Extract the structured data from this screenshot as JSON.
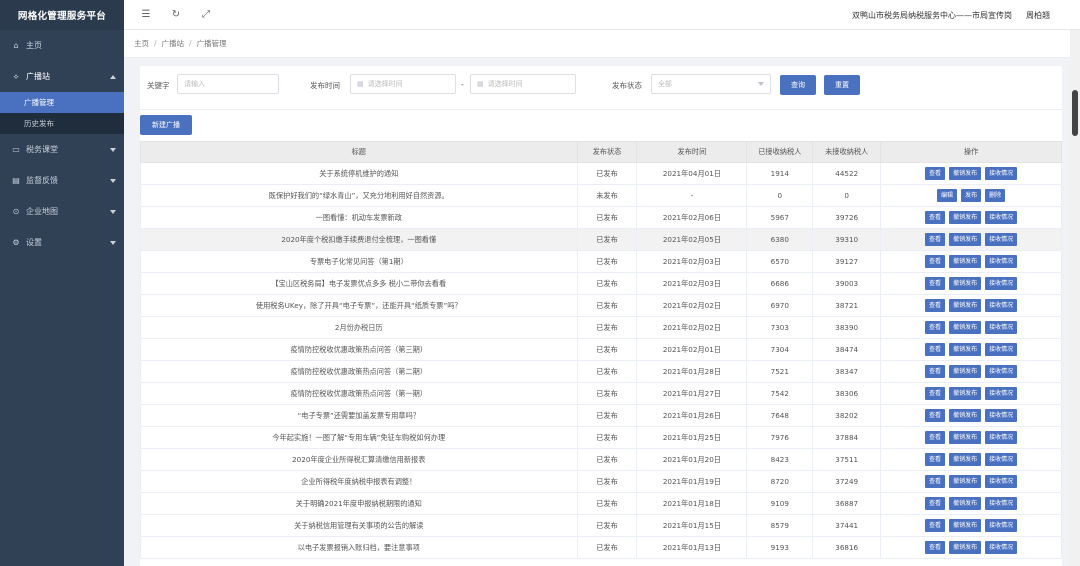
{
  "app": {
    "title": "网格化管理服务平台"
  },
  "sidebar": {
    "items": [
      {
        "icon": "home-icon",
        "glyph": "⌂",
        "label": "主页",
        "has_sub": false
      },
      {
        "icon": "broadcast-icon",
        "glyph": "⟡",
        "label": "广播站",
        "has_sub": true,
        "open": true,
        "children": [
          {
            "label": "广播管理",
            "active": true
          },
          {
            "label": "历史发布",
            "active": false
          }
        ]
      },
      {
        "icon": "classroom-icon",
        "glyph": "▭",
        "label": "税务课堂",
        "has_sub": true
      },
      {
        "icon": "feedback-icon",
        "glyph": "▤",
        "label": "监督反馈",
        "has_sub": true
      },
      {
        "icon": "map-pin-icon",
        "glyph": "⊙",
        "label": "企业地图",
        "has_sub": true
      },
      {
        "icon": "gear-icon",
        "glyph": "⚙",
        "label": "设置",
        "has_sub": true
      }
    ]
  },
  "header": {
    "org": "双鸭山市税务局纳税服务中心——市局宣传岗",
    "user": "周柏翘"
  },
  "breadcrumb": [
    "主页",
    "广播站",
    "广播管理"
  ],
  "filters": {
    "keyword_label": "关键字",
    "keyword_placeholder": "请输入",
    "time_label": "发布时间",
    "time_start_placeholder": "请选择时间",
    "time_end_placeholder": "请选择时间",
    "time_sep": "-",
    "status_label": "发布状态",
    "status_value": "全部",
    "search_label": "查询",
    "reset_label": "重置"
  },
  "new_button": "新建广播",
  "table": {
    "headers": [
      "标题",
      "发布状态",
      "发布时间",
      "已接收纳税人",
      "未接收纳税人",
      "操作"
    ],
    "rows": [
      [
        "关于系统停机维护的通知",
        "已发布",
        "2021年04月01日",
        "1914",
        "44522"
      ],
      [
        "既保护好我们的“绿水青山”，又充分地利用好自然资源。",
        "未发布",
        "-",
        "0",
        "0"
      ],
      [
        "一图看懂：机动车发票新政",
        "已发布",
        "2021年02月06日",
        "5967",
        "39726"
      ],
      [
        "2020年度个税扣缴手续费退付全梳理，一图看懂",
        "已发布",
        "2021年02月05日",
        "6380",
        "39310"
      ],
      [
        "专票电子化常见问答（第1期）",
        "已发布",
        "2021年02月03日",
        "6570",
        "39127"
      ],
      [
        "【宝山区税务局】电子发票优点多多 税小二带你去看看",
        "已发布",
        "2021年02月03日",
        "6686",
        "39003"
      ],
      [
        "使用税务UKey，除了开具“电子专票”，还能开具“纸质专票”吗？",
        "已发布",
        "2021年02月02日",
        "6970",
        "38721"
      ],
      [
        "2月份办税日历",
        "已发布",
        "2021年02月02日",
        "7303",
        "38390"
      ],
      [
        "疫情防控税收优惠政策热点问答（第三期）",
        "已发布",
        "2021年02月01日",
        "7304",
        "38474"
      ],
      [
        "疫情防控税收优惠政策热点问答（第二期）",
        "已发布",
        "2021年01月28日",
        "7521",
        "38347"
      ],
      [
        "疫情防控税收优惠政策热点问答（第一期）",
        "已发布",
        "2021年01月27日",
        "7542",
        "38306"
      ],
      [
        "“电子专票”还需要加盖发票专用章吗？",
        "已发布",
        "2021年01月26日",
        "7648",
        "38202"
      ],
      [
        "今年起实施！一图了解“专用车辆”免征车购税如何办理",
        "已发布",
        "2021年01月25日",
        "7976",
        "37884"
      ],
      [
        "2020年度企业所得税汇算清缴信用新报表",
        "已发布",
        "2021年01月20日",
        "8423",
        "37511"
      ],
      [
        "企业所得税年度纳税申报表有调整！",
        "已发布",
        "2021年01月19日",
        "8720",
        "37249"
      ],
      [
        "关于明确2021年度申报纳税期限的通知",
        "已发布",
        "2021年01月18日",
        "9109",
        "36887"
      ],
      [
        "关于纳税信用管理有关事项的公告的解读",
        "已发布",
        "2021年01月15日",
        "8579",
        "37441"
      ],
      [
        "以电子发票报销入账归档，要注意事项",
        "已发布",
        "2021年01月13日",
        "9193",
        "36816"
      ]
    ],
    "actions_published": [
      "查看",
      "撤销发布",
      "接收情况"
    ],
    "actions_unpublished": [
      "编辑",
      "发布",
      "删除"
    ]
  }
}
